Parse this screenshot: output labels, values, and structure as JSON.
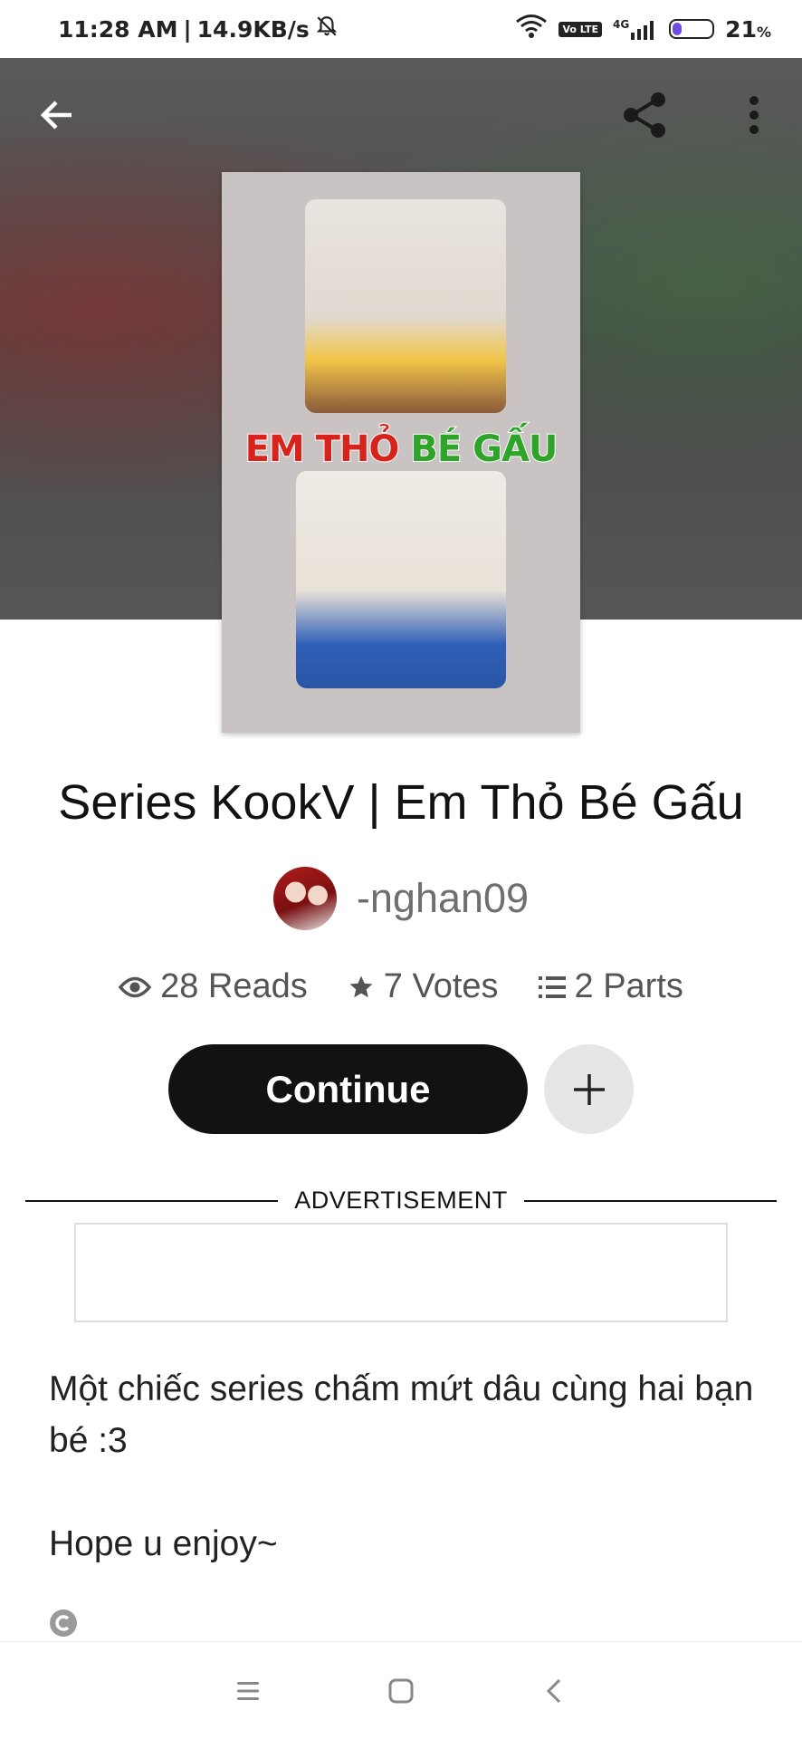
{
  "status_bar": {
    "time": "11:28 AM",
    "speed": "14.9KB/s",
    "network": "4G",
    "lte": "Vo LTE",
    "battery_percent": "21",
    "battery_unit": "%",
    "battery_level": 0.21
  },
  "story": {
    "cover_text_red": "EM THỎ",
    "cover_text_green": "BÉ GẤU",
    "title": "Series KookV | Em Thỏ Bé Gấu",
    "author": "-nghan09",
    "reads": "28 Reads",
    "votes": "7 Votes",
    "parts": "2 Parts",
    "continue_label": "Continue",
    "advertisement_label": "ADVERTISEMENT",
    "description": "Một chiếc series chấm mứt dâu cùng hai bạn bé :3\n\nHope u enjoy~"
  },
  "icons": {
    "back": "back-arrow-icon",
    "share": "share-icon",
    "more": "more-vertical-icon",
    "reads": "eye-icon",
    "votes": "star-icon",
    "parts": "list-icon",
    "add": "plus-icon",
    "copyright": "copyright-icon"
  },
  "colors": {
    "primary_button": "#121212",
    "battery_fill": "#6a4ce6"
  }
}
